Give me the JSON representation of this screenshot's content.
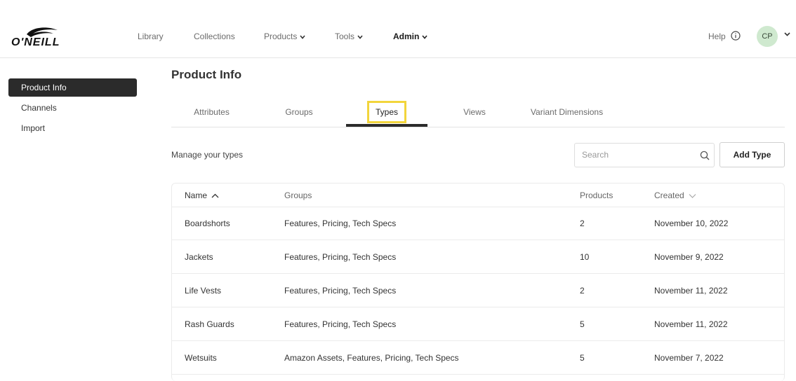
{
  "brand": {
    "name": "O'NEILL"
  },
  "nav": {
    "library": "Library",
    "collections": "Collections",
    "products": "Products",
    "tools": "Tools",
    "admin": "Admin",
    "help": "Help",
    "user_initials": "CP"
  },
  "sidebar": {
    "items": [
      {
        "label": "Product Info",
        "active": true
      },
      {
        "label": "Channels",
        "active": false
      },
      {
        "label": "Import",
        "active": false
      }
    ]
  },
  "page": {
    "title": "Product Info",
    "tabs": [
      {
        "label": "Attributes"
      },
      {
        "label": "Groups"
      },
      {
        "label": "Types",
        "active": true
      },
      {
        "label": "Views"
      },
      {
        "label": "Variant Dimensions"
      }
    ],
    "subtitle": "Manage your types",
    "search_placeholder": "Search",
    "add_button": "Add Type"
  },
  "table": {
    "columns": {
      "name": "Name",
      "groups": "Groups",
      "products": "Products",
      "created": "Created"
    },
    "sort": {
      "column": "Name",
      "direction": "asc"
    },
    "rows": [
      {
        "name": "Boardshorts",
        "groups": "Features, Pricing, Tech Specs",
        "products": "2",
        "created": "November 10, 2022"
      },
      {
        "name": "Jackets",
        "groups": "Features, Pricing, Tech Specs",
        "products": "10",
        "created": "November 9, 2022"
      },
      {
        "name": "Life Vests",
        "groups": "Features, Pricing, Tech Specs",
        "products": "2",
        "created": "November 11, 2022"
      },
      {
        "name": "Rash Guards",
        "groups": "Features, Pricing, Tech Specs",
        "products": "5",
        "created": "November 11, 2022"
      },
      {
        "name": "Wetsuits",
        "groups": "Amazon Assets, Features, Pricing, Tech Specs",
        "products": "5",
        "created": "November 7, 2022"
      }
    ]
  },
  "colors": {
    "accent_dark": "#2b2b2b",
    "highlight": "#f2d53c",
    "avatar_bg": "#cfe9cf"
  },
  "icons": [
    "oneill-logo",
    "chevron-down-icon",
    "info-icon",
    "search-icon",
    "sort-up-icon",
    "sort-down-icon"
  ]
}
